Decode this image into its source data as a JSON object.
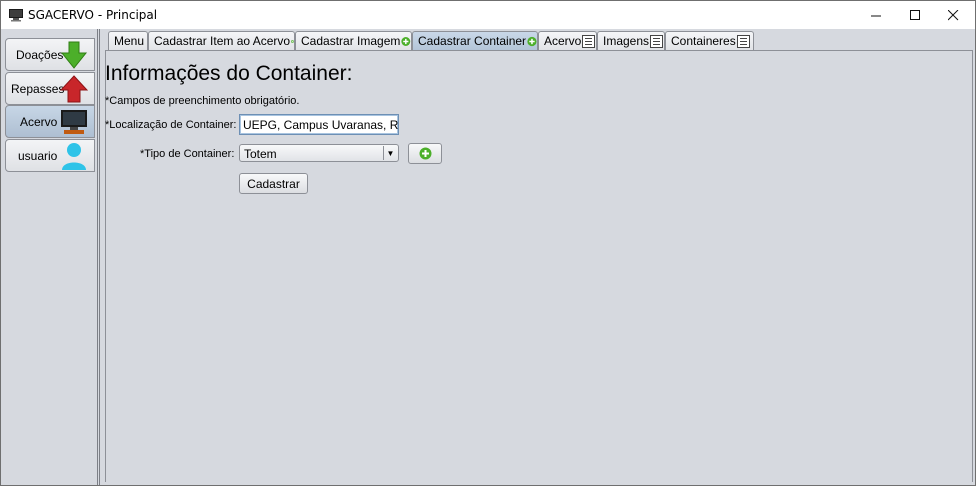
{
  "window": {
    "title": "SGACERVO - Principal",
    "controls": {
      "minimize": "—",
      "maximize": "☐",
      "close": "✕"
    }
  },
  "sidebar": {
    "items": [
      {
        "label": "Doações",
        "icon": "arrow-down-icon",
        "selected": false
      },
      {
        "label": "Repasses",
        "icon": "arrow-up-icon",
        "selected": false
      },
      {
        "label": "Acervo",
        "icon": "computer-icon",
        "selected": true
      },
      {
        "label": "usuario",
        "icon": "user-icon",
        "selected": false
      }
    ]
  },
  "tabs": [
    {
      "label": "Menu",
      "icon": "",
      "selected": false
    },
    {
      "label": "Cadastrar Item ao Acervo",
      "icon": "plus-icon",
      "selected": false
    },
    {
      "label": "Cadastrar Imagem",
      "icon": "plus-icon",
      "selected": false
    },
    {
      "label": "Cadastrar Container",
      "icon": "plus-icon",
      "selected": true
    },
    {
      "label": "Acervo",
      "icon": "list-icon",
      "selected": false
    },
    {
      "label": "Imagens",
      "icon": "list-icon",
      "selected": false
    },
    {
      "label": "Containeres",
      "icon": "list-icon",
      "selected": false
    }
  ],
  "form": {
    "title": "Informações do Container:",
    "required_note": "*Campos de preenchimento obrigatório.",
    "location_label": "*Localização de Container:",
    "location_value": "UEPG, Campus Uvaranas, Reito",
    "type_label": "*Tipo de Container:",
    "type_selected": "Totem",
    "submit_label": "Cadastrar"
  },
  "colors": {
    "accent_green": "#4caf2a",
    "arrow_red": "#c8262a",
    "user_cyan": "#2ec3e8",
    "selected_tab": "#b8c9dc"
  }
}
